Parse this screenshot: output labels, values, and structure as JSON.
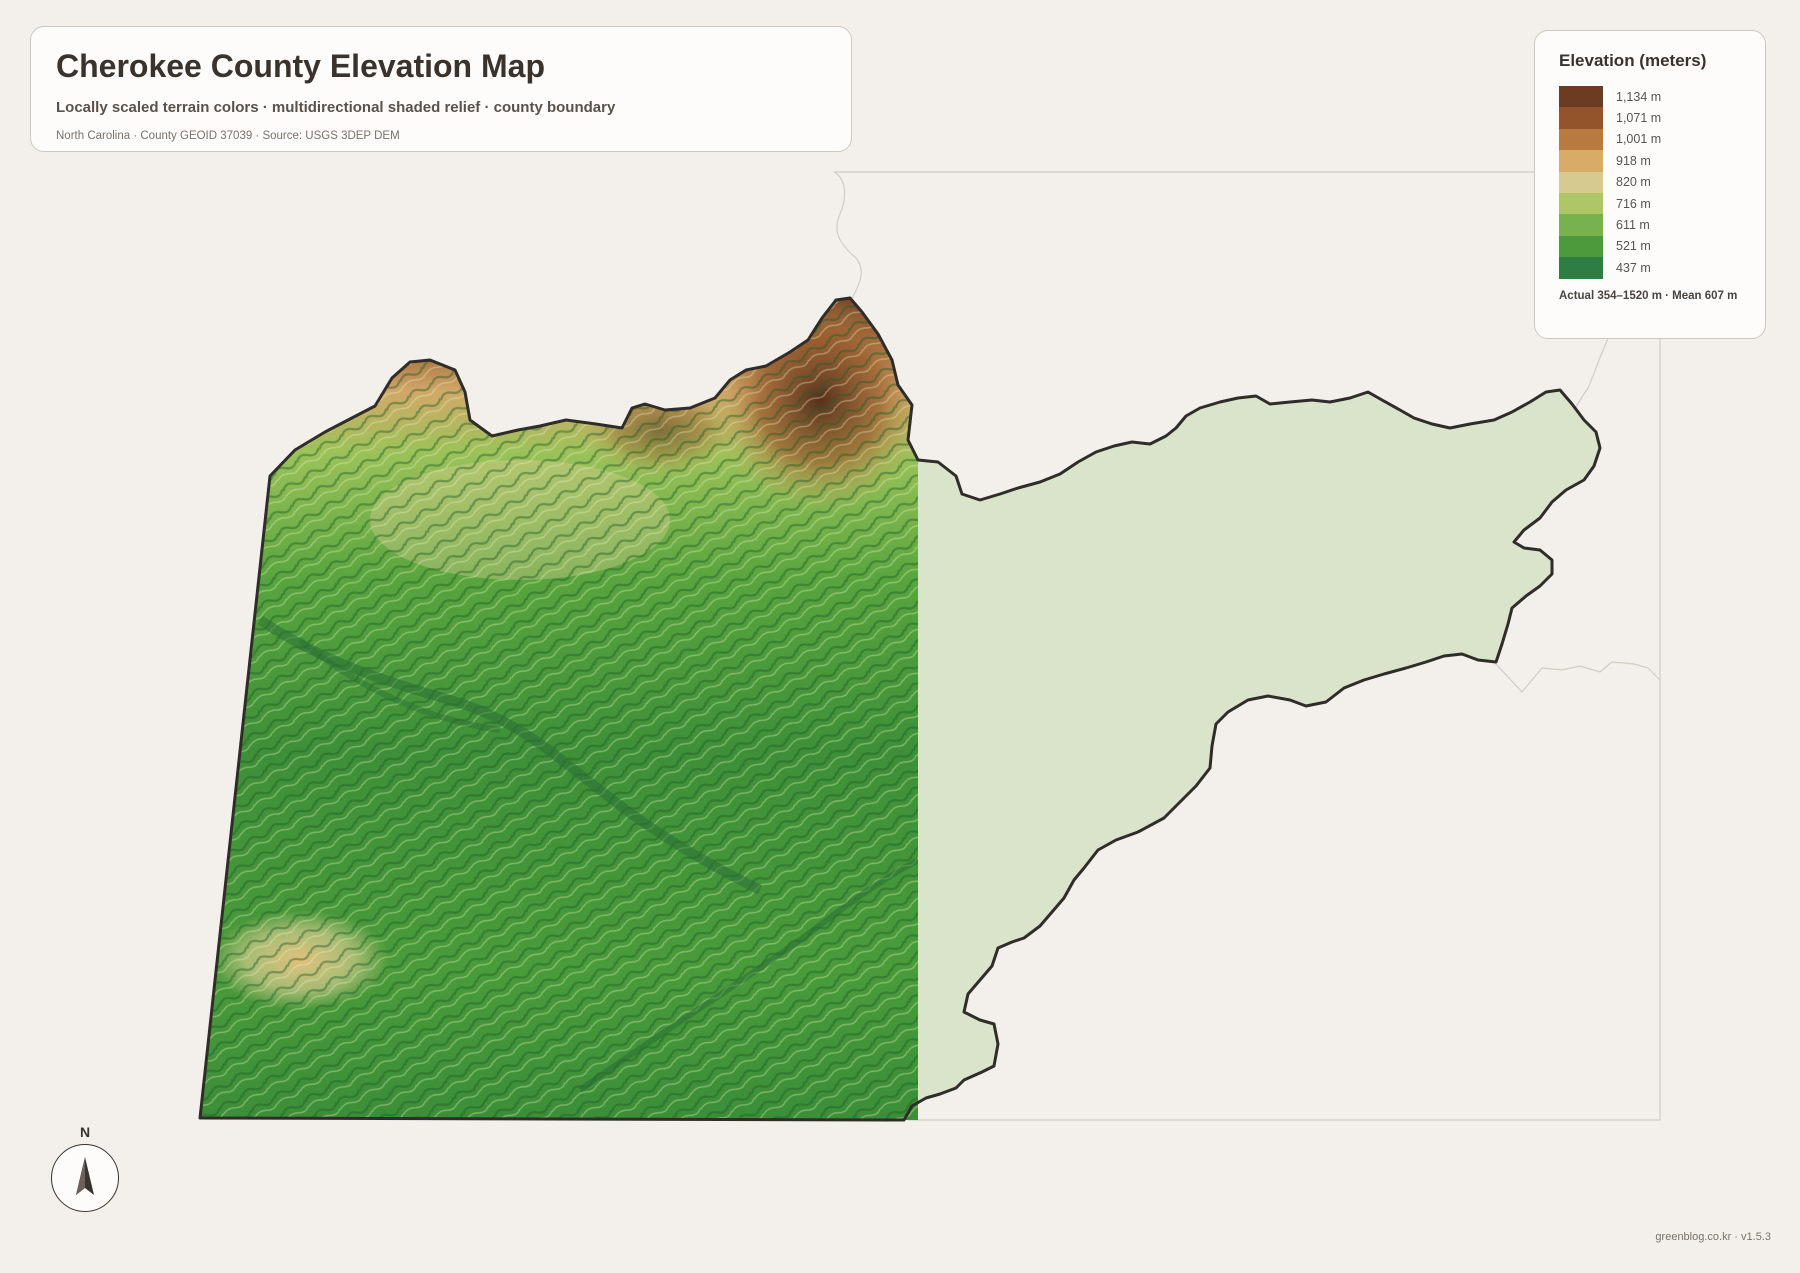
{
  "header": {
    "title": "Cherokee County Elevation Map",
    "subtitle": "Locally scaled terrain colors · multidirectional shaded relief · county boundary",
    "source": "North Carolina · County GEOID 37039 · Source: USGS 3DEP DEM"
  },
  "legend": {
    "title": "Elevation (meters)",
    "items": [
      {
        "label": "1,134 m",
        "color": "#6b3b22"
      },
      {
        "label": "1,071 m",
        "color": "#93542c"
      },
      {
        "label": "1,001 m",
        "color": "#b97a3f"
      },
      {
        "label": "918 m",
        "color": "#d8ac67"
      },
      {
        "label": "820 m",
        "color": "#d6ca8e"
      },
      {
        "label": "716 m",
        "color": "#aec766"
      },
      {
        "label": "611 m",
        "color": "#78b24c"
      },
      {
        "label": "521 m",
        "color": "#4b9b3d"
      },
      {
        "label": "437 m",
        "color": "#2e7d42"
      }
    ],
    "note": "Actual 354–1520 m · Mean 607 m"
  },
  "compass": {
    "label": "N"
  },
  "credit": "greenblog.co.kr · v1.5.3",
  "colors": {
    "background": "#f3f0ec",
    "county_fill_flat": "#dae4ca",
    "boundary": "#2f2c29"
  }
}
